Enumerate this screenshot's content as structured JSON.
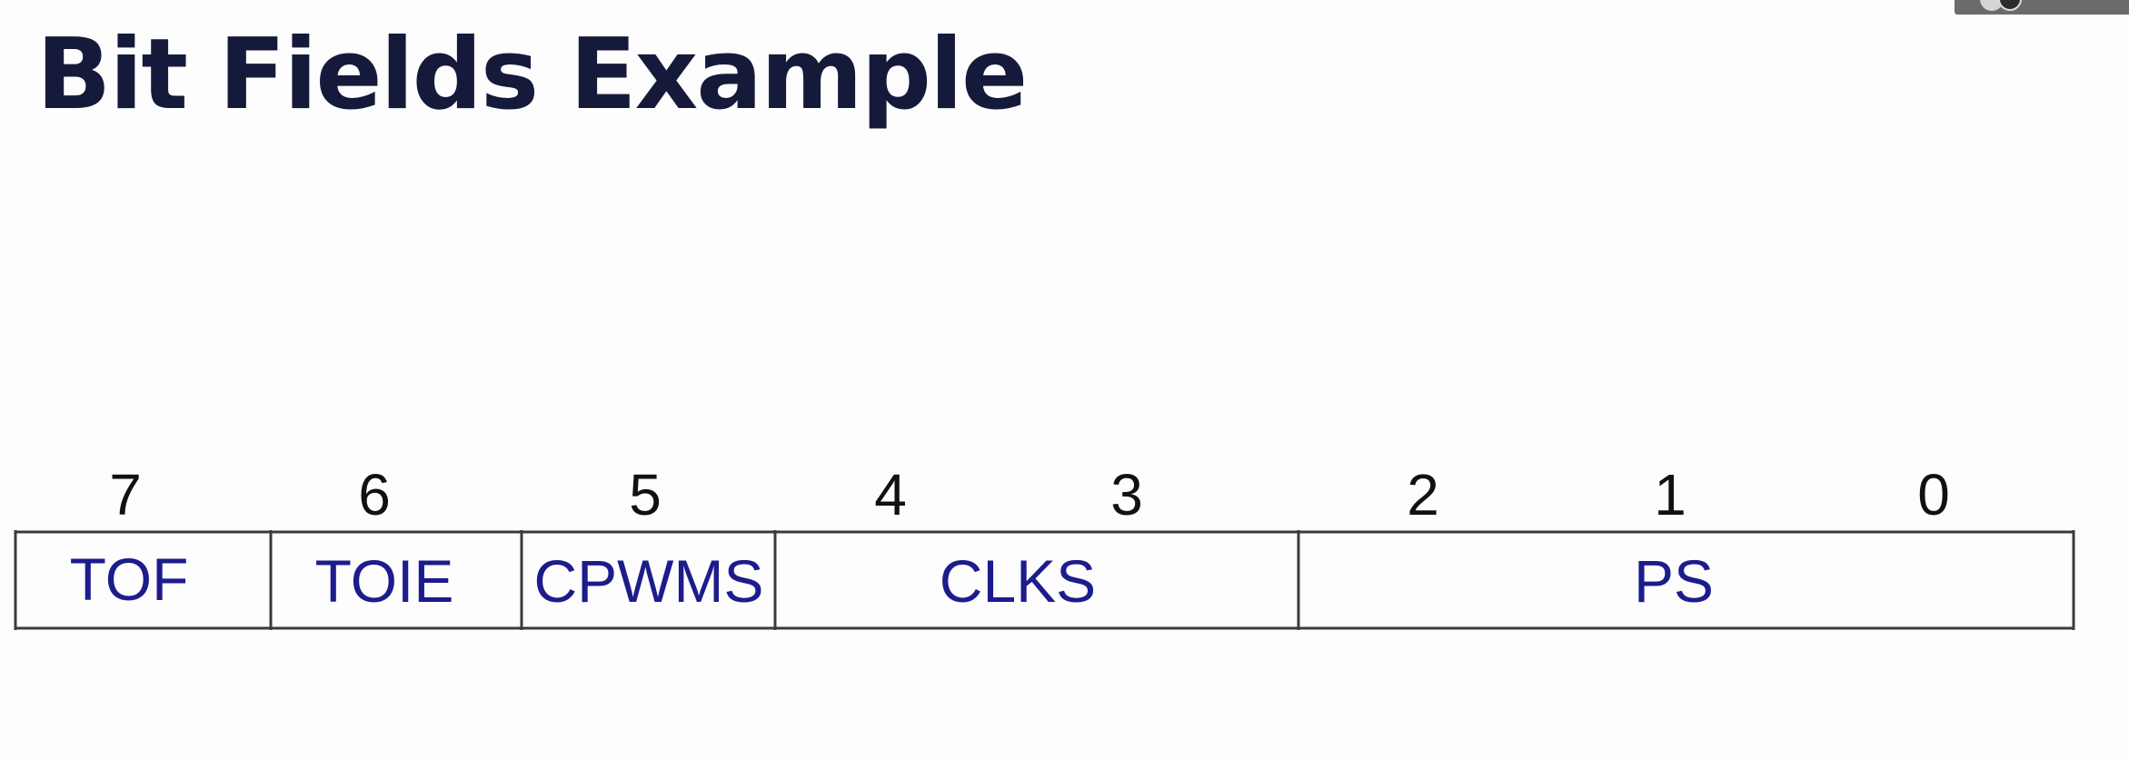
{
  "title": "Bit Fields Example",
  "register": {
    "bit_numbers": [
      "7",
      "6",
      "5",
      "4",
      "3",
      "2",
      "1",
      "0"
    ],
    "fields": [
      {
        "name": "TOF",
        "bits": [
          7
        ]
      },
      {
        "name": "TOIE",
        "bits": [
          6
        ]
      },
      {
        "name": "CPWMS",
        "bits": [
          5
        ]
      },
      {
        "name": "CLKS",
        "bits": [
          4,
          3
        ]
      },
      {
        "name": "PS",
        "bits": [
          2,
          1,
          0
        ]
      }
    ]
  },
  "colors": {
    "title": "#161a3a",
    "field_text": "#1c1c8c",
    "bit_text": "#111111",
    "lines": "#3a3a3a"
  }
}
